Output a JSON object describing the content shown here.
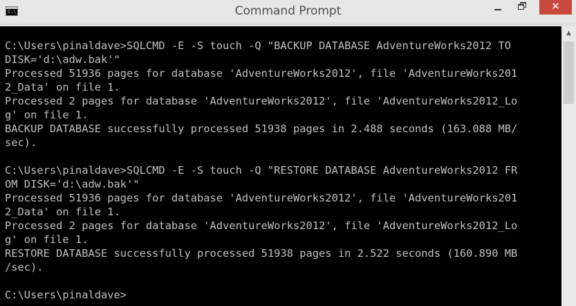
{
  "window": {
    "title": "Command Prompt",
    "icon": "cmd-icon",
    "icon_text": "C:\\_"
  },
  "titlebar_buttons": {
    "minimize_icon": "minimize-icon",
    "maximize_icon": "restore-icon",
    "close_icon": "close-icon",
    "close_glyph": "✕"
  },
  "colors": {
    "console_background": "#000000",
    "console_text": "#c0c0c0",
    "close_button": "#c9483c"
  },
  "console": {
    "lines": [
      "C:\\Users\\pinaldave>SQLCMD -E -S touch -Q \"BACKUP DATABASE AdventureWorks2012 TO",
      "DISK='d:\\adw.bak'\"",
      "Processed 51936 pages for database 'AdventureWorks2012', file 'AdventureWorks201",
      "2_Data' on file 1.",
      "Processed 2 pages for database 'AdventureWorks2012', file 'AdventureWorks2012_Lo",
      "g' on file 1.",
      "BACKUP DATABASE successfully processed 51938 pages in 2.488 seconds (163.088 MB/",
      "sec).",
      "",
      "C:\\Users\\pinaldave>SQLCMD -E -S touch -Q \"RESTORE DATABASE AdventureWorks2012 FR",
      "OM DISK='d:\\adw.bak'\"",
      "Processed 51936 pages for database 'AdventureWorks2012', file 'AdventureWorks201",
      "2_Data' on file 1.",
      "Processed 2 pages for database 'AdventureWorks2012', file 'AdventureWorks2012_Lo",
      "g' on file 1.",
      "RESTORE DATABASE successfully processed 51938 pages in 2.522 seconds (160.890 MB",
      "/sec).",
      "",
      "C:\\Users\\pinaldave>"
    ]
  },
  "scrollbar": {
    "up_arrow": "▲"
  }
}
